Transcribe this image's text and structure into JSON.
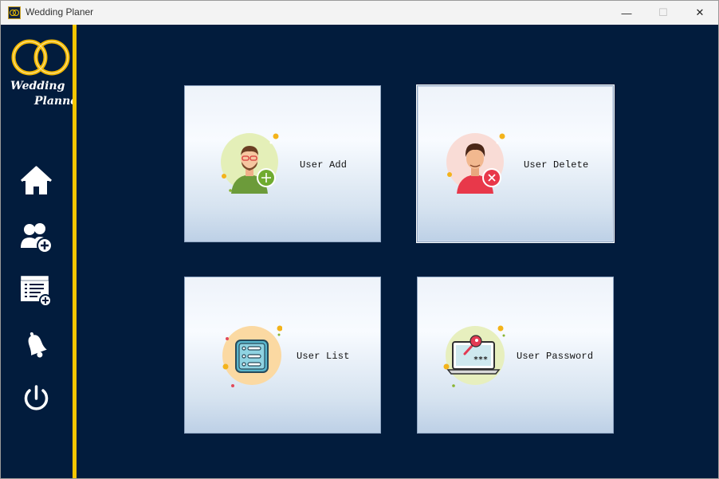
{
  "window": {
    "title": "Wedding Planer",
    "controls": {
      "minimize": "—",
      "maximize": "☐",
      "close": "✕"
    }
  },
  "logo": {
    "line1": "Wedding",
    "line2": "Planner"
  },
  "sidebar": {
    "items": [
      {
        "icon": "home-icon"
      },
      {
        "icon": "add-user-icon"
      },
      {
        "icon": "add-list-icon"
      },
      {
        "icon": "bell-icon"
      },
      {
        "icon": "power-icon"
      }
    ]
  },
  "cards": [
    {
      "label": "User Add",
      "icon": "user-add-icon",
      "active": false
    },
    {
      "label": "User Delete",
      "icon": "user-delete-icon",
      "active": true
    },
    {
      "label": "User List",
      "icon": "list-icon",
      "active": false
    },
    {
      "label": "User Password",
      "icon": "laptop-key-icon",
      "active": false
    }
  ],
  "colors": {
    "background": "#021c3d",
    "accent": "#f6c500",
    "card_gradient_top": "#eef3fa",
    "card_gradient_bottom": "#bdd0e6"
  }
}
